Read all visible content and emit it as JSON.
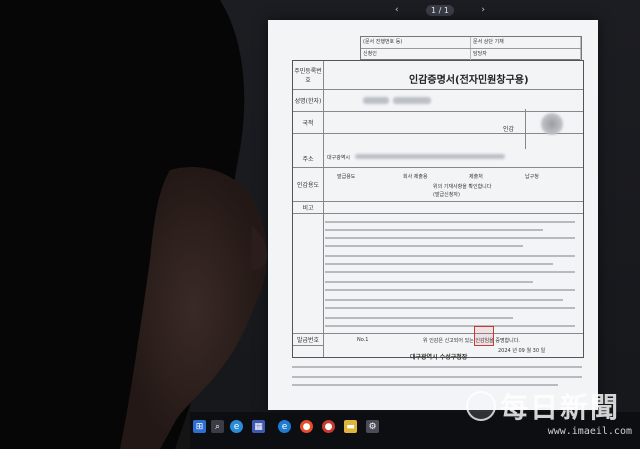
{
  "viewer": {
    "prev": "‹",
    "page": "1 / 1",
    "next": "›"
  },
  "document": {
    "top_labels": [
      "(문서 진행번호 등)",
      "신청인",
      "담당자",
      "",
      "문서 상단 기재"
    ],
    "title": "인감증명서(전자민원창구용)",
    "row_labels": [
      "주민등록번호",
      "성명(한자)",
      "국적",
      "주소",
      "인감용도",
      "비고"
    ],
    "seal_label": "인감",
    "address_prefix": "대구광역시",
    "usage": {
      "col1": "발급용도",
      "col2": "회사 제출용",
      "col3": "제출처",
      "col4": "납구청",
      "note": "위의 기재사항을 확인합니다",
      "sub": "(발급신청자)"
    },
    "issue_number_label": "발급번호",
    "issue_number": "No.1",
    "certify_text": "위 인감은 신고되어 있는 인감임을 증명합니다.",
    "date": "2024 년 09 월 30 일",
    "issuer": "대구광역시 수성구청장"
  },
  "watermark": {
    "brand": "每日新聞",
    "url": "www.imaeil.com"
  },
  "taskbar": {
    "icons": [
      "windows-icon",
      "search-icon",
      "explorer-icon",
      "edge-icon",
      "ie-icon",
      "chrome-icon",
      "app-icon",
      "folder-icon",
      "settings-icon"
    ]
  },
  "colors": {
    "document_bg": "#f3f4f6",
    "stamp": "#c73b3b",
    "screen_bg": "#1c1d22"
  }
}
